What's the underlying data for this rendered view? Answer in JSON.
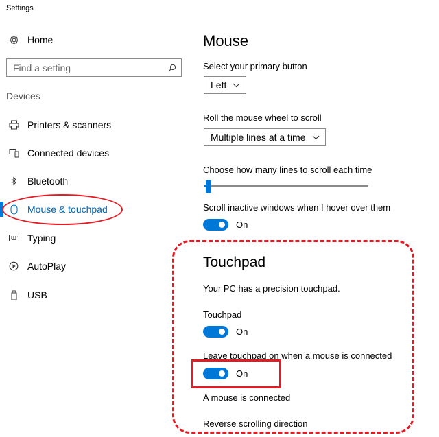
{
  "window": {
    "title": "Settings"
  },
  "sidebar": {
    "home": {
      "label": "Home",
      "icon": "gear-icon"
    },
    "search": {
      "placeholder": "Find a setting",
      "icon": "search-icon"
    },
    "section_label": "Devices",
    "items": [
      {
        "label": "Printers & scanners",
        "icon": "printer-icon",
        "active": false
      },
      {
        "label": "Connected devices",
        "icon": "devices-icon",
        "active": false
      },
      {
        "label": "Bluetooth",
        "icon": "bluetooth-icon",
        "active": false
      },
      {
        "label": "Mouse & touchpad",
        "icon": "mouse-icon",
        "active": true
      },
      {
        "label": "Typing",
        "icon": "keyboard-icon",
        "active": false
      },
      {
        "label": "AutoPlay",
        "icon": "autoplay-icon",
        "active": false
      },
      {
        "label": "USB",
        "icon": "usb-icon",
        "active": false
      }
    ]
  },
  "mouse": {
    "title": "Mouse",
    "primary_button": {
      "label": "Select your primary button",
      "value": "Left"
    },
    "wheel_scroll": {
      "label": "Roll the mouse wheel to scroll",
      "value": "Multiple lines at a time"
    },
    "lines_to_scroll": {
      "label": "Choose how many lines to scroll each time",
      "fraction": 0.03
    },
    "scroll_inactive": {
      "label": "Scroll inactive windows when I hover over them",
      "state": "On"
    }
  },
  "touchpad": {
    "title": "Touchpad",
    "description": "Your PC has a precision touchpad.",
    "touchpad_toggle": {
      "label": "Touchpad",
      "state": "On"
    },
    "leave_on": {
      "label": "Leave touchpad on when a mouse is connected",
      "state": "On"
    },
    "mouse_connected": "A mouse is connected",
    "reverse_scrolling": "Reverse scrolling direction"
  },
  "colors": {
    "accent": "#0078d7",
    "active_text": "#0063b1",
    "annotation": "#e21b24"
  }
}
